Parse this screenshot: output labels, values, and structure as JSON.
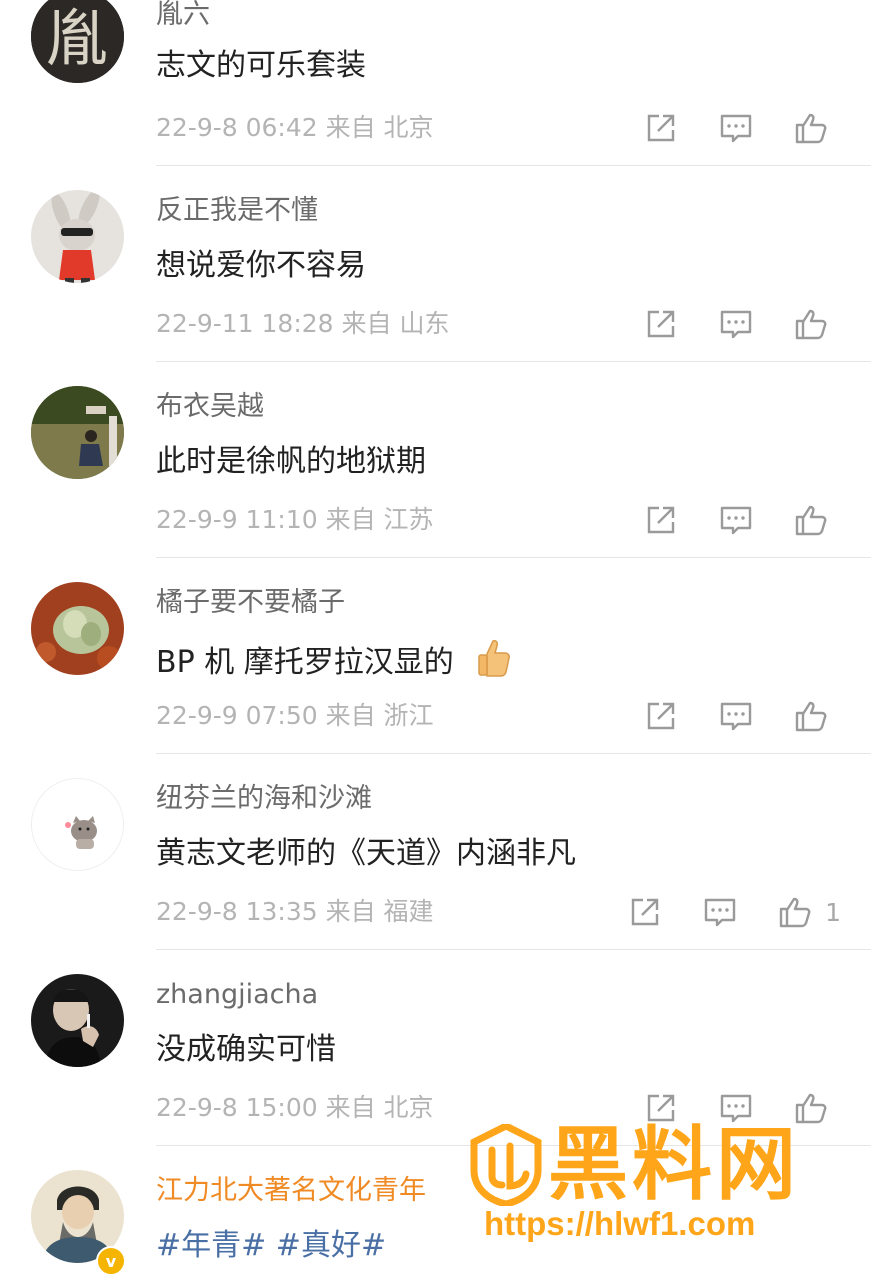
{
  "comments": [
    {
      "user": "胤六",
      "text": "志文的可乐套装",
      "meta": "22-9-8 06:42  来自 北京",
      "likes": ""
    },
    {
      "user": "反正我是不懂",
      "text": "想说爱你不容易",
      "meta": "22-9-11 18:28  来自 山东",
      "likes": ""
    },
    {
      "user": "布衣吴越",
      "text": "此时是徐帆的地狱期",
      "meta": "22-9-9 11:10  来自 江苏",
      "likes": ""
    },
    {
      "user": "橘子要不要橘子",
      "text": "BP 机 摩托罗拉汉显的",
      "meta": "22-9-9 07:50  来自 浙江",
      "likes": ""
    },
    {
      "user": "纽芬兰的海和沙滩",
      "text": "黄志文老师的《天道》内涵非凡",
      "meta": "22-9-8 13:35  来自 福建",
      "likes": "1"
    },
    {
      "user": "zhangjiacha",
      "text": "没成确实可惜",
      "meta": "22-9-8 15:00  来自 北京",
      "likes": ""
    },
    {
      "user": "江力北大著名文化青年",
      "text": "#年青# #真好#",
      "meta": "",
      "likes": ""
    }
  ],
  "avatar_glyph": "胤",
  "verified_badge": "v",
  "watermark": {
    "title": "黑料网",
    "url": "https://hlwf1.com"
  },
  "icons": {
    "share": "share-icon",
    "comment": "comment-icon",
    "like": "thumbs-up-icon",
    "emoji": "thumbs-up-emoji"
  },
  "colors": {
    "username": "#6b6b6b",
    "username_vip": "#f08a24",
    "meta": "#b4b4b4",
    "topic": "#4a6fa5",
    "watermark": "#ffa51a"
  }
}
